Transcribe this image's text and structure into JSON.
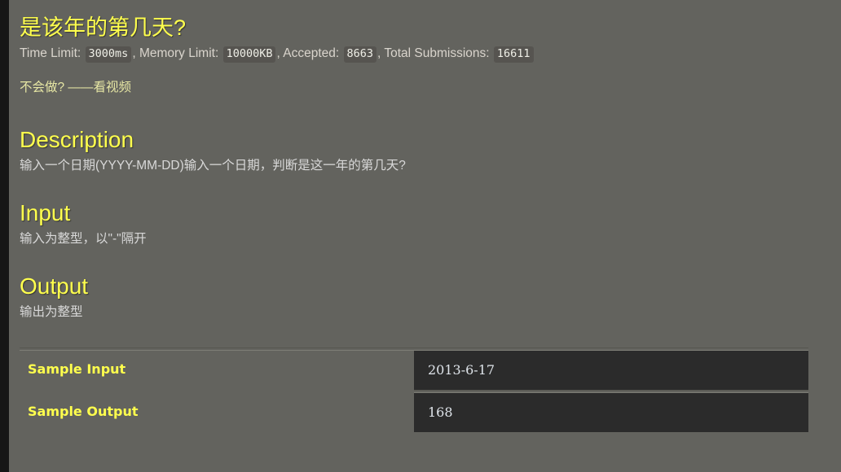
{
  "problem": {
    "title": "是该年的第几天?",
    "stats": {
      "time_limit_label": "Time Limit:",
      "time_limit_value": "3000ms",
      "sep1": ", ",
      "memory_limit_label": "Memory Limit:",
      "memory_limit_value": "10000KB",
      "sep2": ", ",
      "accepted_label": "Accepted:",
      "accepted_value": "8663",
      "sep3": ", ",
      "total_submissions_label": "Total Submissions:",
      "total_submissions_value": "16611"
    },
    "help_line": {
      "prefix": "不会做?",
      "dash": " ——",
      "link_text": "看视频"
    }
  },
  "sections": [
    {
      "heading": "Description",
      "body": "输入一个日期(YYYY-MM-DD)输入一个日期，判断是这一年的第几天?"
    },
    {
      "heading": "Input",
      "body": "输入为整型，以\"-\"隔开"
    },
    {
      "heading": "Output",
      "body": "输出为整型"
    }
  ],
  "samples": [
    {
      "label": "Sample Input",
      "value": "2013-6-17"
    },
    {
      "label": "Sample Output",
      "value": "168"
    }
  ],
  "colors": {
    "page_background": "#63635e",
    "gutter": "#161616",
    "heading_yellow": "#ffff4d",
    "body_text": "#d8d8d8",
    "stats_text": "#d9d4cc",
    "badge_background": "#565450",
    "sample_box_background": "#2b2b2b",
    "sample_value_text": "#dfe4ea",
    "link_khaki": "#e6e6a4"
  }
}
